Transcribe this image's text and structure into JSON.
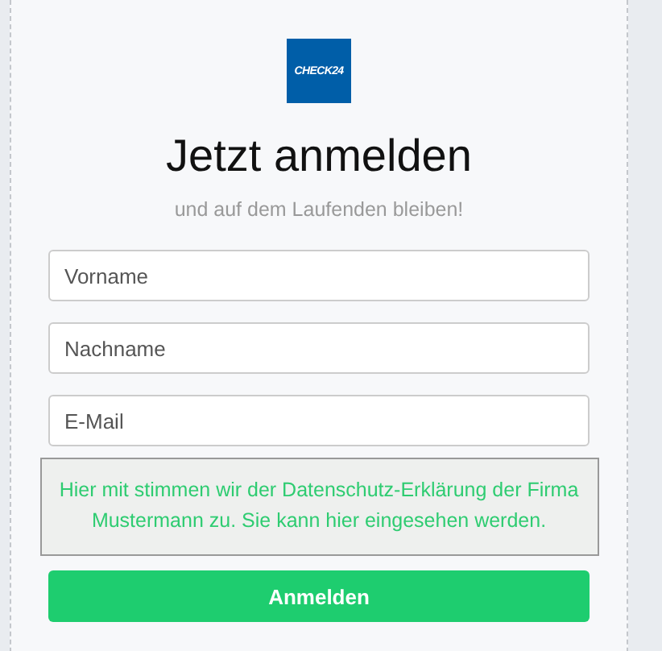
{
  "logo": {
    "text": "CHECK24"
  },
  "title": "Jetzt anmelden",
  "subtitle": "und auf dem Laufenden bleiben!",
  "fields": [
    {
      "placeholder": "Vorname"
    },
    {
      "placeholder": "Nachname"
    },
    {
      "placeholder": "E-Mail"
    }
  ],
  "privacy_notice": "Hier mit stimmen wir der Datenschutz-Erklärung der Firma Mustermann zu. Sie kann hier eingesehen werden.",
  "submit_button": "Anmelden"
}
